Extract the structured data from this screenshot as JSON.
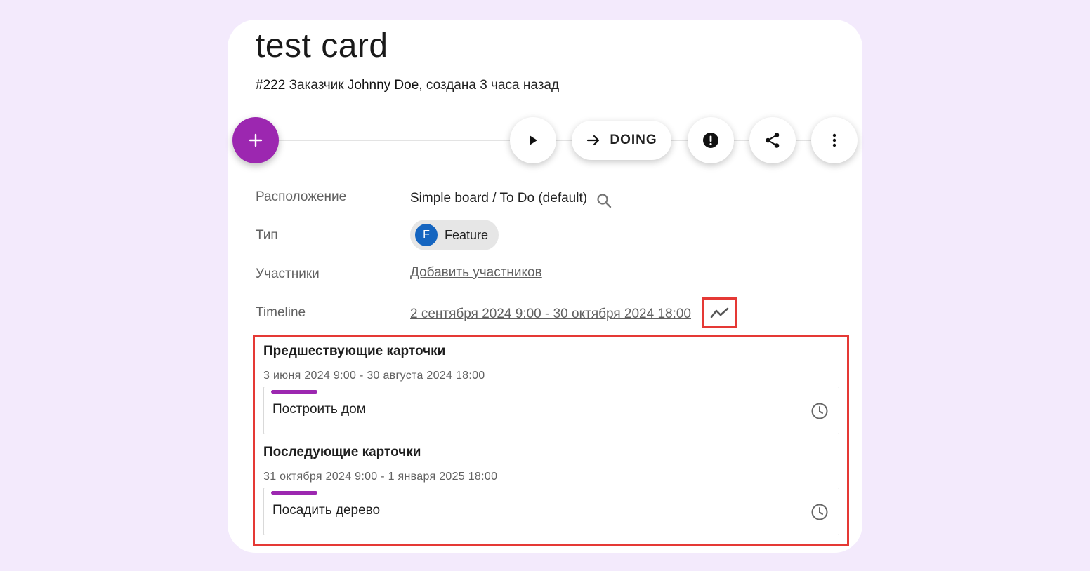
{
  "card": {
    "title": "test card",
    "number": "#222",
    "customer_prefix": "Заказчик",
    "customer": "Johnny Doe",
    "created": ", создана 3 часа назад"
  },
  "toolbar": {
    "add_icon": "plus-icon",
    "play_icon": "play-icon",
    "move_label": "DOING",
    "move_icon": "arrow-right-icon",
    "block_icon": "exclamation-circle-icon",
    "share_icon": "share-icon",
    "more_icon": "more-vertical-icon"
  },
  "fields": {
    "location_label": "Расположение",
    "location_value": "Simple board / To Do (default)",
    "type_label": "Тип",
    "type_letter": "F",
    "type_value": "Feature",
    "members_label": "Участники",
    "members_value": "Добавить участников",
    "timeline_label": "Timeline",
    "timeline_value": "2 сентября 2024 9:00 - 30 октября 2024 18:00"
  },
  "dependencies": {
    "predecessors_title": "Предшествующие карточки",
    "predecessors_date": "3 июня 2024 9:00 - 30 августа 2024 18:00",
    "predecessors_card": "Построить дом",
    "successors_title": "Последующие карточки",
    "successors_date": "31 октября 2024 9:00 - 1 января 2025 18:00",
    "successors_card": "Посадить дерево"
  },
  "colors": {
    "accent": "#9c27b0",
    "highlight": "#e53935",
    "type_avatar": "#1565c0",
    "background": "#f3eafc"
  }
}
